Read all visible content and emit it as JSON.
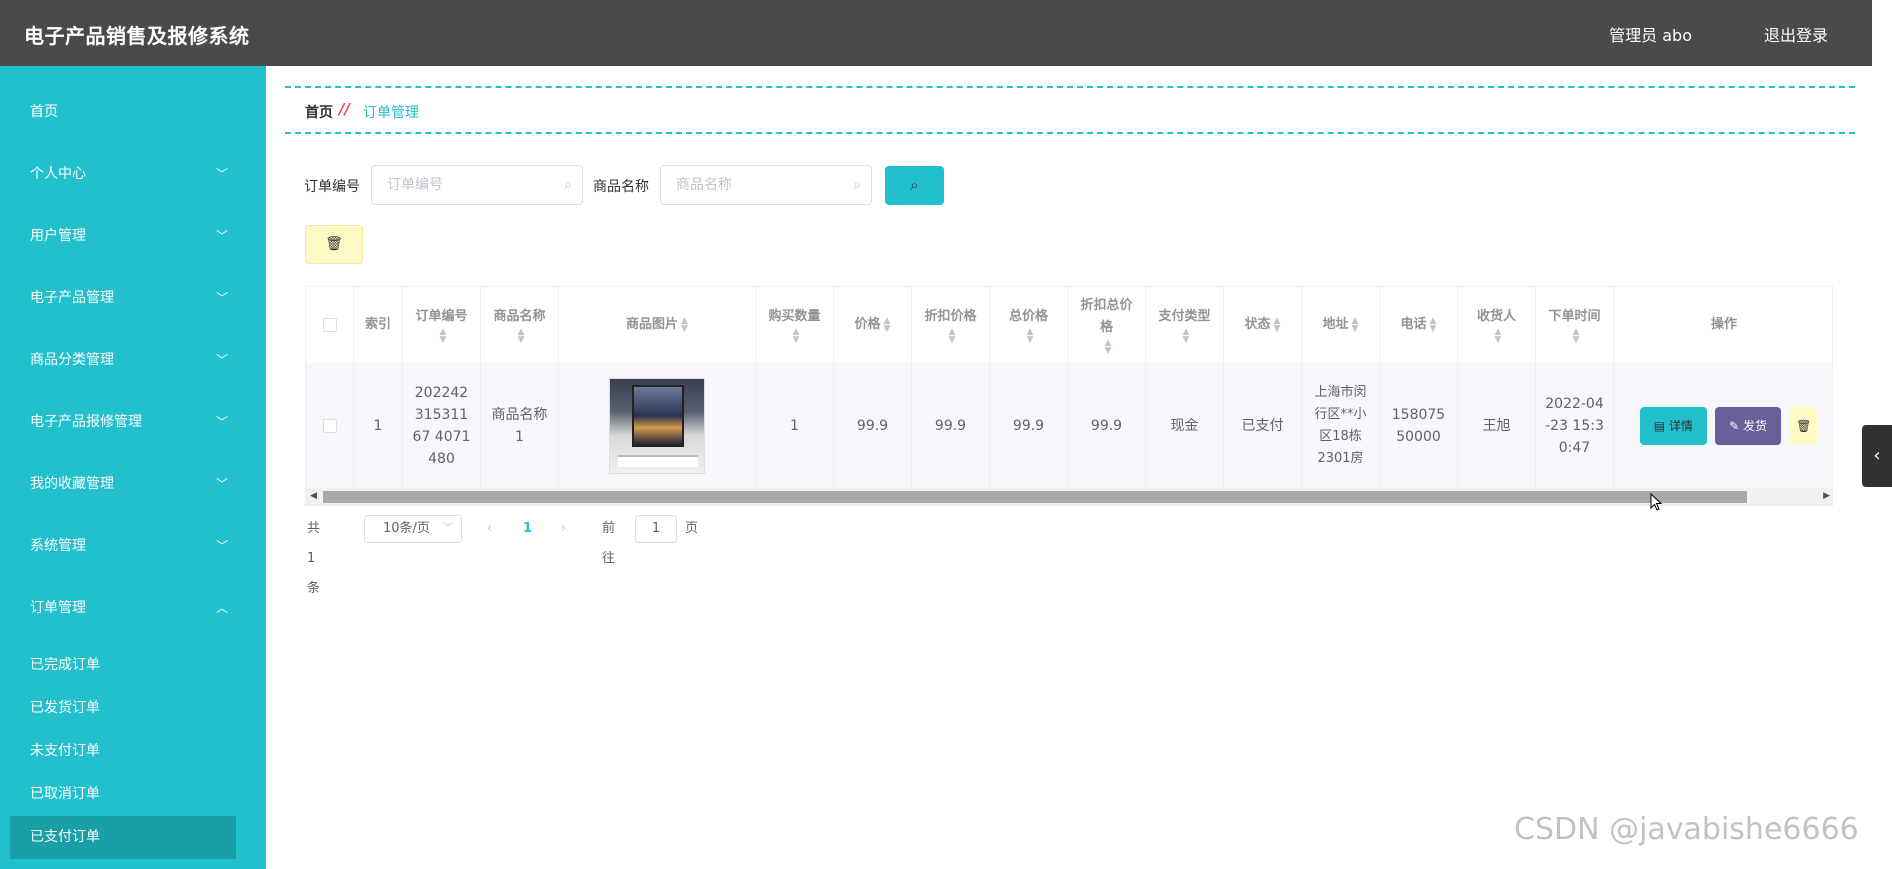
{
  "app": {
    "title": "电子产品销售及报修系统"
  },
  "header": {
    "user": "管理员 abo",
    "logout": "退出登录"
  },
  "sidebar": {
    "items": [
      {
        "label": "首页",
        "expandable": false
      },
      {
        "label": "个人中心",
        "expandable": true
      },
      {
        "label": "用户管理",
        "expandable": true
      },
      {
        "label": "电子产品管理",
        "expandable": true
      },
      {
        "label": "商品分类管理",
        "expandable": true
      },
      {
        "label": "电子产品报修管理",
        "expandable": true
      },
      {
        "label": "我的收藏管理",
        "expandable": true
      },
      {
        "label": "系统管理",
        "expandable": true
      },
      {
        "label": "订单管理",
        "expandable": true,
        "expanded": true
      }
    ],
    "subitems": [
      {
        "label": "已完成订单"
      },
      {
        "label": "已发货订单"
      },
      {
        "label": "未支付订单"
      },
      {
        "label": "已取消订单"
      },
      {
        "label": "已支付订单",
        "active": true
      }
    ]
  },
  "breadcrumb": {
    "home": "首页",
    "separator": "//",
    "current": "订单管理"
  },
  "search": {
    "order_no_label": "订单编号",
    "order_no_placeholder": "订单编号",
    "product_label": "商品名称",
    "product_placeholder": "商品名称",
    "search_icon": "search-icon"
  },
  "toolbar": {
    "delete_icon": "trash-icon"
  },
  "table": {
    "headers": {
      "index": "索引",
      "order_no": "订单编号",
      "product_name": "商品名称",
      "product_image": "商品图片",
      "quantity": "购买数量",
      "price": "价格",
      "discount_price": "折扣价格",
      "total_price": "总价格",
      "discount_total": "折扣总价格",
      "pay_type": "支付类型",
      "status": "状态",
      "address": "地址",
      "phone": "电话",
      "receiver": "收货人",
      "order_time": "下单时间",
      "actions": "操作"
    },
    "rows": [
      {
        "index": "1",
        "order_no": "20224231531167 4071480",
        "product_name": "商品名称1",
        "quantity": "1",
        "price": "99.9",
        "discount_price": "99.9",
        "total_price": "99.9",
        "discount_total": "99.9",
        "pay_type": "现金",
        "status": "已支付",
        "address": "上海市闵行区**小区18栋2301房",
        "phone": "15807550000",
        "receiver": "王旭",
        "order_time": "2022-04-23 15:30:47"
      }
    ],
    "actions": {
      "detail": "详情",
      "ship": "发货"
    }
  },
  "pager": {
    "total": "共 1 条",
    "page_size": "10条/页",
    "current_page": "1",
    "goto_label": "前往",
    "goto_value": "1",
    "page_suffix": "页"
  },
  "watermark": "CSDN @javabishe6666",
  "colors": {
    "accent": "#22bfcc",
    "topbar": "#4a4a4a",
    "ship": "#6a5f9a",
    "delete": "#fff9c4",
    "active_sub": "#189fa8"
  }
}
